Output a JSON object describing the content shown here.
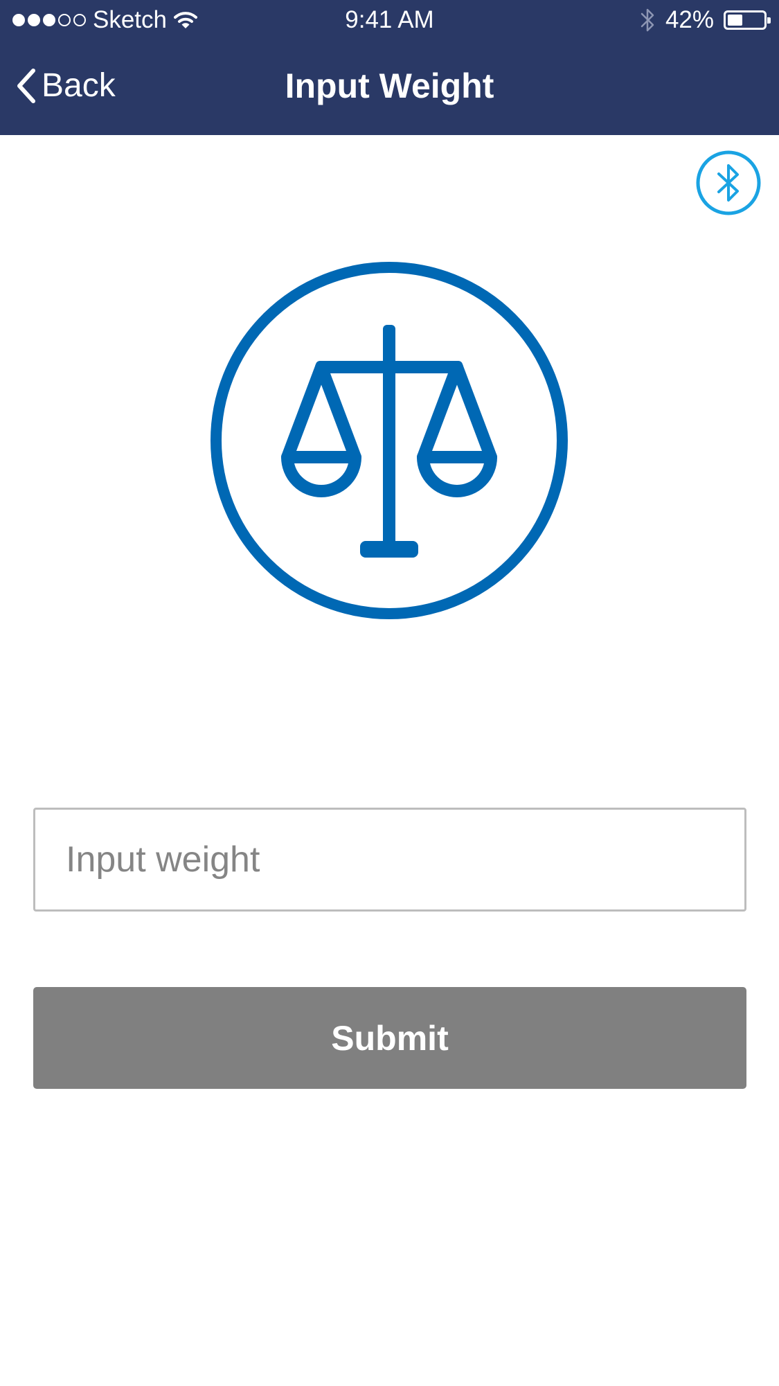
{
  "status_bar": {
    "carrier": "Sketch",
    "time": "9:41 AM",
    "battery_percent": "42%",
    "battery_level": 0.42,
    "signal_bars_filled": 3,
    "signal_bars_total": 5
  },
  "nav": {
    "back_label": "Back",
    "title": "Input Weight"
  },
  "icons": {
    "bluetooth": "bluetooth-icon",
    "scale": "balance-scale-icon"
  },
  "form": {
    "weight_placeholder": "Input weight",
    "weight_value": "",
    "submit_label": "Submit"
  },
  "colors": {
    "header_bg": "#2a3966",
    "accent_blue": "#0068b4",
    "bluetooth_blue": "#1aa3e3",
    "submit_bg": "#808080",
    "input_border": "#bdbdbd"
  }
}
